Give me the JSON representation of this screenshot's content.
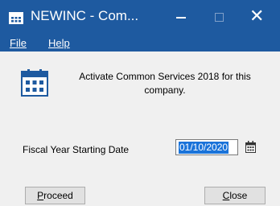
{
  "window": {
    "title": "NEWINC - Com...",
    "controls": {
      "close_glyph": "✕"
    }
  },
  "menu": {
    "file": {
      "access_key": "F",
      "rest": "ile"
    },
    "help": {
      "access_key": "H",
      "rest": "elp"
    }
  },
  "message": "Activate Common Services 2018  for this company.",
  "fiscal": {
    "label": "Fiscal Year Starting Date",
    "value": "01/10/2020"
  },
  "buttons": {
    "proceed": {
      "access_key": "P",
      "rest": "roceed"
    },
    "close": {
      "access_key": "C",
      "rest": "lose"
    }
  },
  "icons": {
    "app": "calendar-icon",
    "large": "calendar-icon",
    "date_picker": "calendar-icon"
  },
  "colors": {
    "titlebar": "#1e5aa0",
    "selection": "#1a73d9",
    "dialog_bg": "#f0f0f0"
  }
}
